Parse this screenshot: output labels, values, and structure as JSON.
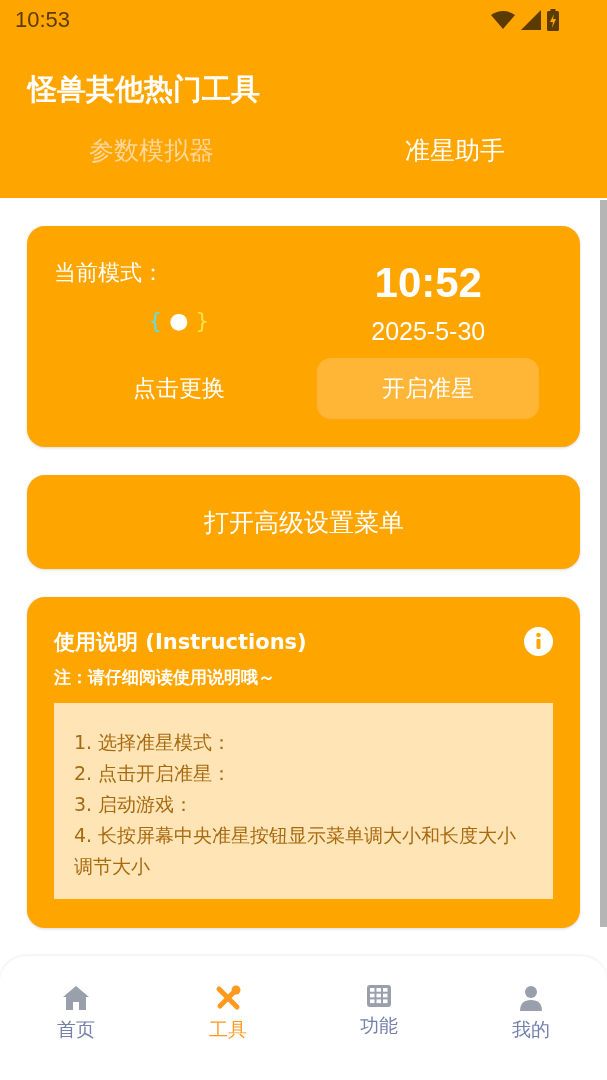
{
  "status_bar": {
    "time": "10:53"
  },
  "header": {
    "title": "怪兽其他热门工具"
  },
  "tabs": [
    {
      "label": "参数模拟器",
      "selected": false
    },
    {
      "label": "准星助手",
      "selected": true
    }
  ],
  "mode_card": {
    "label": "当前模式：",
    "mode_symbol": {
      "left": "{",
      "center": "●",
      "right": "}"
    },
    "change_link": "点击更换",
    "clock": "10:52",
    "date": "2025-5-30",
    "start_button": "开启准星"
  },
  "advanced_button": "打开高级设置菜单",
  "instructions": {
    "title": "使用说明 (Instructions)",
    "note": "注：请仔细阅读使用说明哦～",
    "steps": [
      "1. 选择准星模式：",
      "2. 点击开启准星：",
      "3. 启动游戏：",
      "4. 长按屏幕中央准星按钮显示菜单调大小和长度大小调节大小"
    ]
  },
  "bottom_nav": [
    {
      "label": "首页",
      "kind": "home",
      "selected": false
    },
    {
      "label": "工具",
      "kind": "tools",
      "selected": true
    },
    {
      "label": "功能",
      "kind": "grid",
      "selected": false
    },
    {
      "label": "我的",
      "kind": "user",
      "selected": false
    }
  ]
}
